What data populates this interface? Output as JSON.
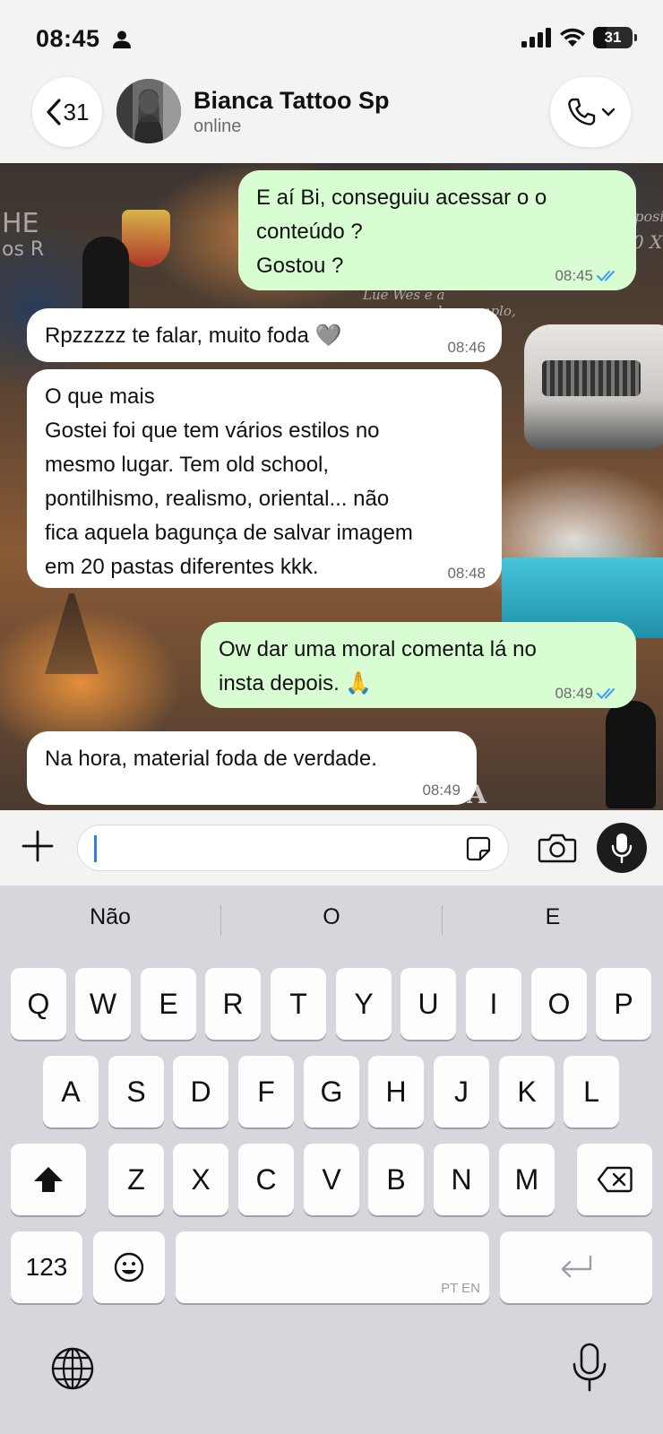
{
  "status_bar": {
    "time": "08:45",
    "battery": "31"
  },
  "header": {
    "back_count": "31",
    "contact_name": "Bianca Tattoo Sp",
    "contact_status": "online"
  },
  "messages": [
    {
      "direction": "out",
      "lines": [
        "E aí Bi, conseguiu acessar o o",
        "conteúdo ?",
        "Gostou ?"
      ],
      "time": "08:45",
      "read": true
    },
    {
      "direction": "in",
      "lines": [
        "Rpzzzzz te falar, muito foda 🩶"
      ],
      "time": "08:46"
    },
    {
      "direction": "in",
      "lines": [
        "O que mais",
        "Gostei foi que tem vários estilos no",
        "mesmo lugar. Tem old school,",
        "pontilhismo, realismo, oriental... não",
        "fica aquela bagunça de salvar imagem",
        "em 20 pastas diferentes kkk."
      ],
      "time": "08:48"
    },
    {
      "direction": "out",
      "lines": [
        "Ow dar uma moral comenta lá no",
        "insta depois. 🙏"
      ],
      "time": "08:49",
      "read": true
    },
    {
      "direction": "in",
      "lines": [
        "Na hora, material foda de verdade."
      ],
      "time": "08:49"
    }
  ],
  "wallpaper_text": [
    "HE",
    "os R",
    "sposi",
    "0 X",
    "Lue Wes e a",
    "pelo exemplo,",
    "LANDA"
  ],
  "input": {
    "value": ""
  },
  "keyboard": {
    "suggestions": [
      "Não",
      "O",
      "E"
    ],
    "row1": [
      "Q",
      "W",
      "E",
      "R",
      "T",
      "Y",
      "U",
      "I",
      "O",
      "P"
    ],
    "row2": [
      "A",
      "S",
      "D",
      "F",
      "G",
      "H",
      "J",
      "K",
      "L"
    ],
    "row3": [
      "Z",
      "X",
      "C",
      "V",
      "B",
      "N",
      "M"
    ],
    "numbers_label": "123",
    "space_languages": "PT EN"
  },
  "colors": {
    "outgoing_bubble": "#d9fdd3",
    "incoming_bubble": "#ffffff",
    "read_ticks": "#3b9df2",
    "caret": "#2f7cf6"
  },
  "icons": [
    "person-icon",
    "signal-icon",
    "wifi-icon",
    "battery-icon",
    "chevron-left-icon",
    "phone-icon",
    "chevron-down-icon",
    "plus-icon",
    "sticker-icon",
    "camera-icon",
    "mic-icon",
    "shift-icon",
    "backspace-icon",
    "emoji-icon",
    "return-icon",
    "globe-icon"
  ]
}
